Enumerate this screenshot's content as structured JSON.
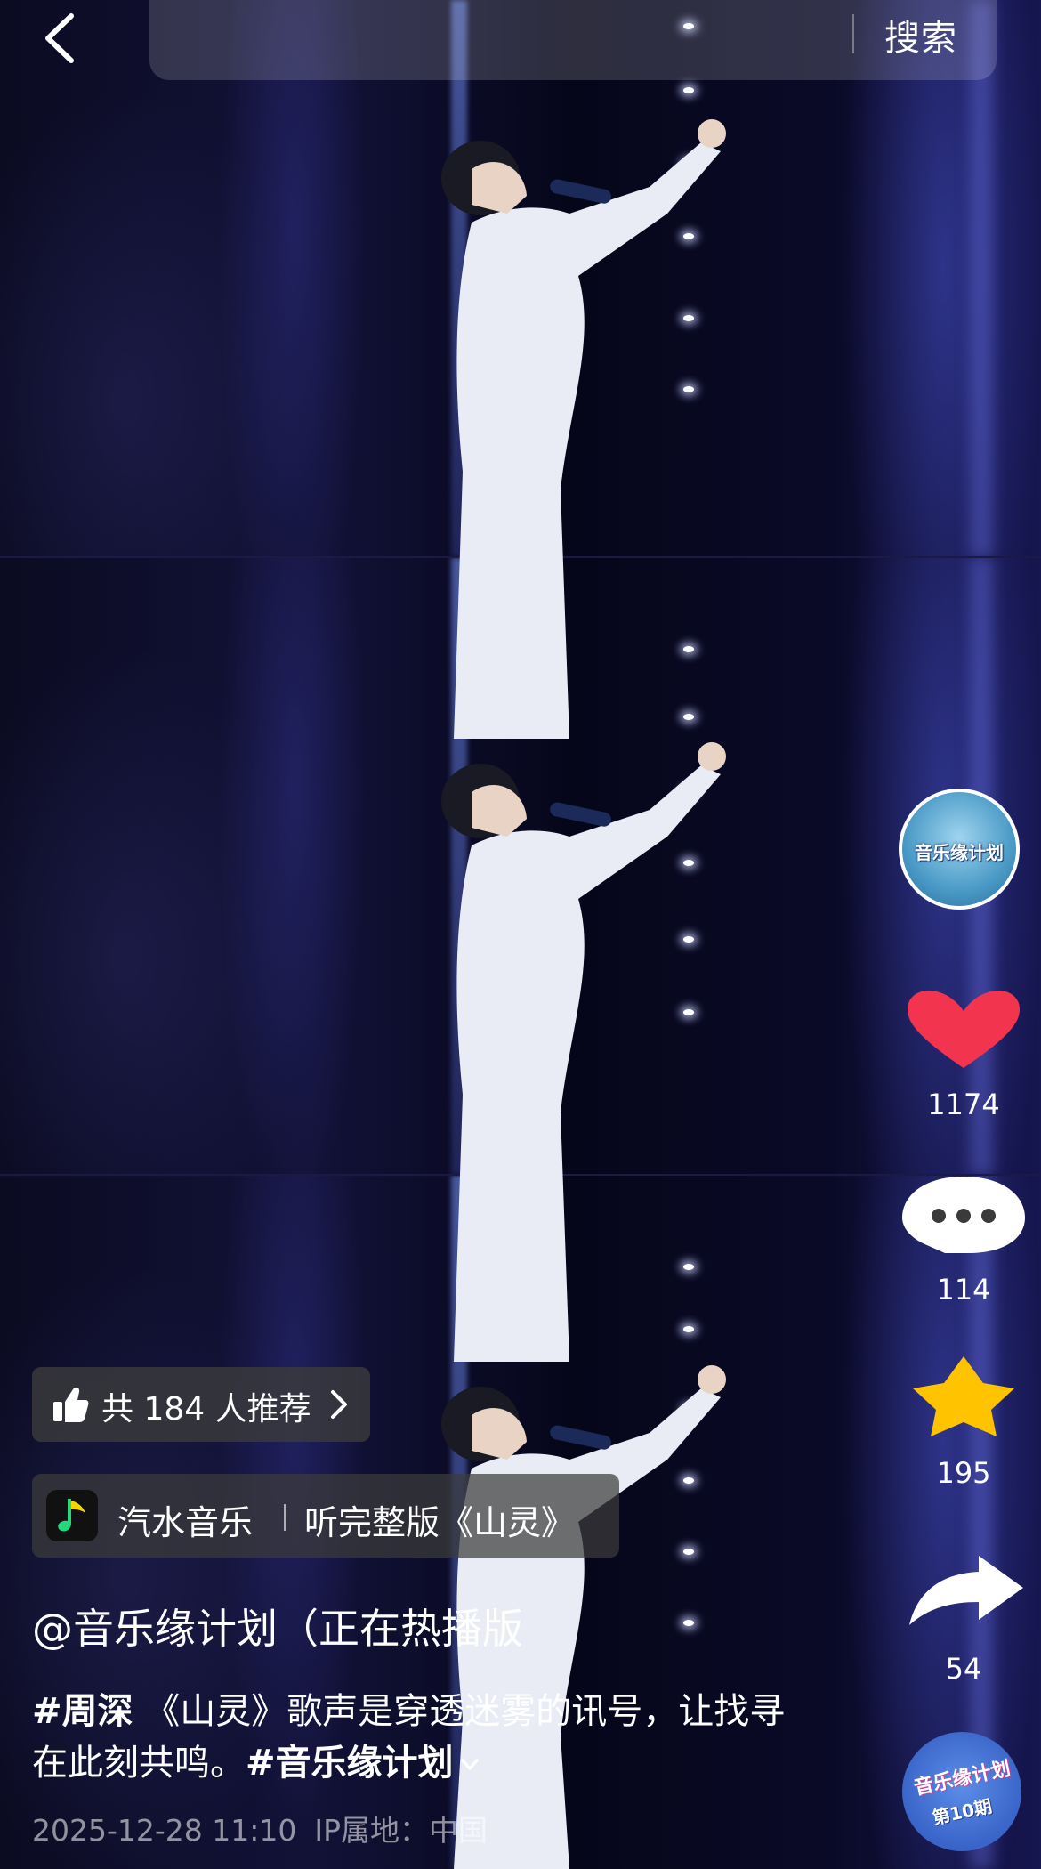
{
  "header": {
    "search_button_label": "搜索"
  },
  "rail": {
    "account_avatar_text": "音乐缘计划",
    "likes": "1174",
    "comments": "114",
    "favorites": "195",
    "shares": "54",
    "music_disc_text": "音乐缘计划",
    "music_disc_episode": "第10期",
    "colors": {
      "like_heart": "#f2344f",
      "favorite_star": "#ffc300"
    }
  },
  "recommend": {
    "label": "共 184 人推荐"
  },
  "music": {
    "app_name": "汽水音乐",
    "cta": "听完整版《山灵》"
  },
  "post": {
    "author": "@音乐缘计划（正在热播版",
    "hashtag_1": "#周深",
    "text": " 《山灵》歌声是穿透迷雾的讯号，让找寻在此刻共鸣。",
    "hashtag_2": "#音乐缘计划",
    "date": "2025-12-28 11:10",
    "ip_location": "IP属地：中国"
  }
}
